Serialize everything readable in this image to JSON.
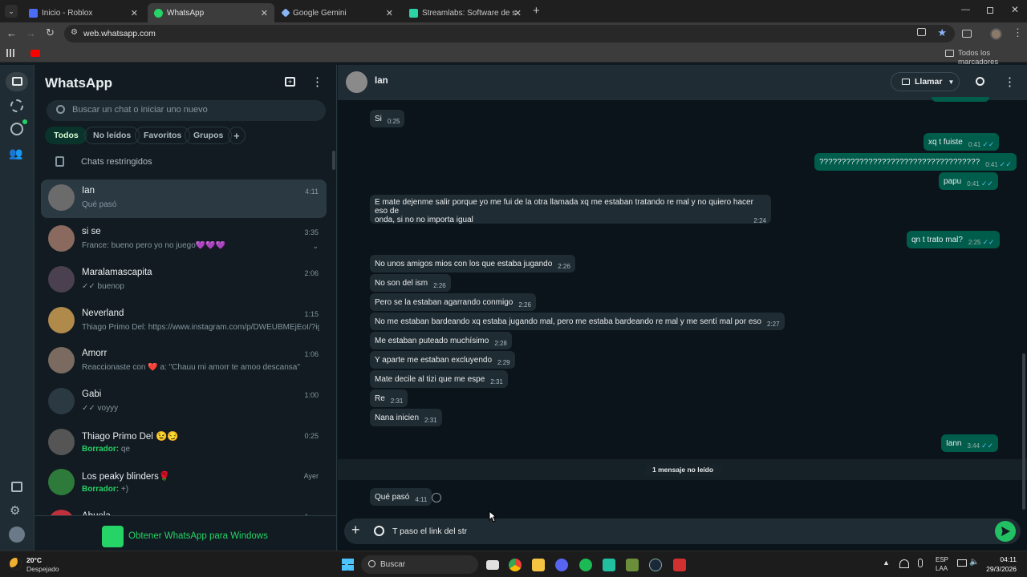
{
  "browser": {
    "tabs": [
      {
        "title": "Inicio - Roblox",
        "color": "#4a6cf7"
      },
      {
        "title": "WhatsApp",
        "color": "#25d366"
      },
      {
        "title": "Google Gemini",
        "color": "#8ab4f8"
      },
      {
        "title": "Streamlabs: Software de stream",
        "color": "#2bd4a4"
      }
    ],
    "url": "web.whatsapp.com",
    "bookmarks_label": "Todos los marcadores"
  },
  "sidebar": {
    "title": "WhatsApp",
    "search_placeholder": "Buscar un chat o iniciar uno nuevo",
    "filters": [
      "Todos",
      "No leídos",
      "Favoritos",
      "Grupos"
    ],
    "restricted": "Chats restringidos",
    "chats": [
      {
        "name": "Ian",
        "time": "4:11",
        "preview": "Qué pasó",
        "avatar": "#6b6b6b"
      },
      {
        "name": "si se",
        "time": "3:35",
        "preview": "France: bueno pero yo no juego💜💜💜",
        "avatar": "#8a6a5e"
      },
      {
        "name": "Maralamascapita",
        "time": "2:06",
        "preview": "✓✓ buenop",
        "avatar": "#4a4050"
      },
      {
        "name": "Neverland",
        "time": "1:15",
        "preview": "Thiago Primo Del: https://www.instagram.com/p/DWEUBMEjEoI/?ig...",
        "avatar": "#b08a4a"
      },
      {
        "name": "Amorr",
        "time": "1:06",
        "preview": "Reaccionaste con ❤️ a: \"Chauu mi amorr te amoo descansa\"",
        "avatar": "#7a6a60"
      },
      {
        "name": "Gabi",
        "time": "1:00",
        "preview": "✓✓ voyyy",
        "avatar": "#2a3942"
      },
      {
        "name": "Thiago Primo Del 😉😏",
        "time": "0:25",
        "draft_label": "Borrador:",
        "preview": "qe",
        "avatar": "#555"
      },
      {
        "name": "Los peaky blinders🌹",
        "time": "Ayer",
        "draft_label": "Borrador:",
        "preview": "+)",
        "avatar": "#2e7a3a"
      },
      {
        "name": "Abuela",
        "time": "Ayer",
        "preview": "",
        "avatar": "#c0303a"
      }
    ],
    "promo": "Obtener WhatsApp para Windows"
  },
  "chat": {
    "contact": "Ian",
    "call_label": "Llamar",
    "messages": [
      {
        "dir": "in",
        "text": "Si",
        "time": "0:25"
      },
      {
        "dir": "out",
        "text": "xq t fuiste",
        "time": "0:41"
      },
      {
        "dir": "out",
        "text": "????????????????????????????????????",
        "time": "0:41"
      },
      {
        "dir": "out",
        "text": "papu",
        "time": "0:41"
      },
      {
        "dir": "in",
        "text": "E mate dejenme salir porque yo me fui de la otra llamada xq me estaban tratando re mal y no quiero hacer eso de",
        "text2": "onda, si no no importa igual",
        "time": "2:24"
      },
      {
        "dir": "out",
        "text": "qn t trato mal?",
        "time": "2:25"
      },
      {
        "dir": "in",
        "text": "No unos amigos mios con los que estaba jugando",
        "time": "2:26"
      },
      {
        "dir": "in",
        "text": "No son del ism",
        "time": "2:26"
      },
      {
        "dir": "in",
        "text": "Pero se la estaban agarrando conmigo",
        "time": "2:26"
      },
      {
        "dir": "in",
        "text": "No me estaban bardeando xq estaba jugando mal, pero me estaba bardeando re mal y me sentí mal por eso",
        "time": "2:27"
      },
      {
        "dir": "in",
        "text": "Me estaban puteado muchísimo",
        "time": "2:28"
      },
      {
        "dir": "in",
        "text": "Y aparte me estaban excluyendo",
        "time": "2:29"
      },
      {
        "dir": "in",
        "text": "Mate decile al tizi que me espe",
        "time": "2:31"
      },
      {
        "dir": "in",
        "text": "Re",
        "time": "2:31"
      },
      {
        "dir": "in",
        "text": "Nana inicien",
        "time": "2:31"
      },
      {
        "dir": "out",
        "text": "Iann",
        "time": "3:44"
      },
      {
        "dir": "in",
        "text": "Qué pasó",
        "time": "4:11"
      }
    ],
    "unread_banner": "1 mensaje no leído",
    "input_value": "T paso el link del str"
  },
  "taskbar": {
    "temp": "20°C",
    "weather": "Despejado",
    "search": "Buscar",
    "lang1": "ESP",
    "lang2": "LAA",
    "time": "04:11",
    "date": "29/3/2026"
  }
}
